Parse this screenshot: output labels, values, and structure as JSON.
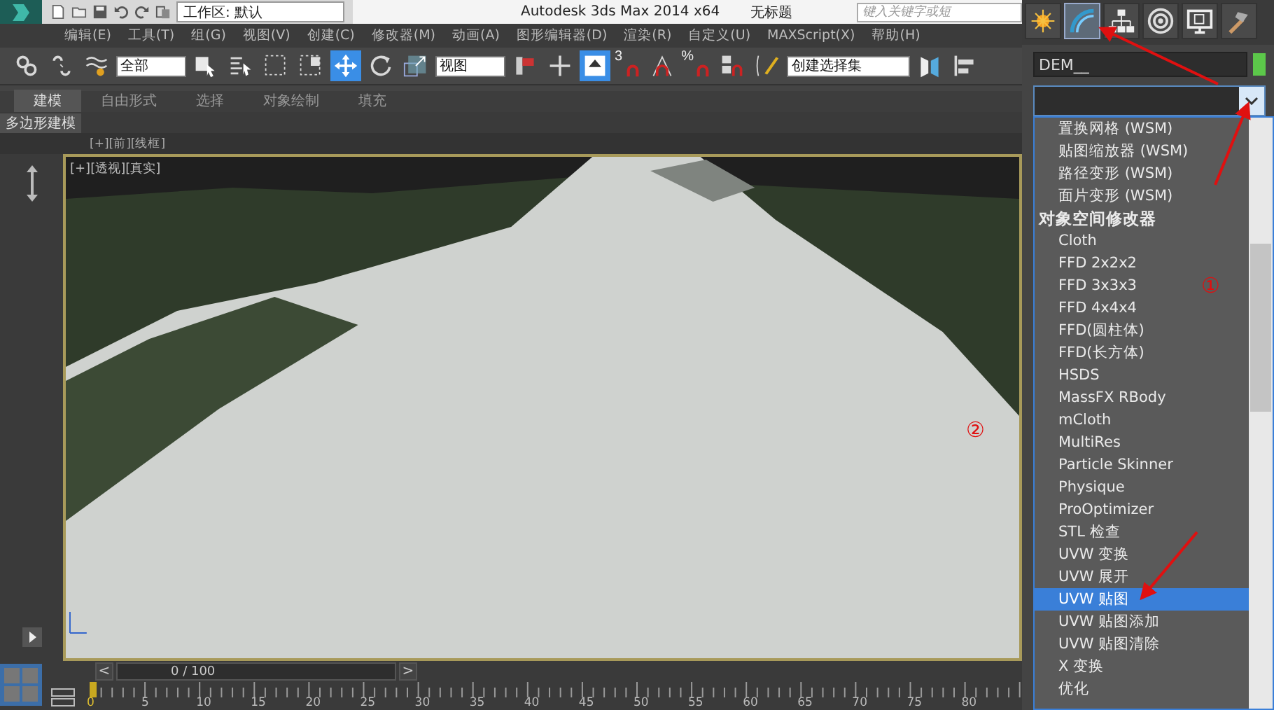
{
  "title_bar": {
    "workspace": "工作区: 默认",
    "app_title": "Autodesk 3ds Max  2014 x64",
    "document": "无标题",
    "search": {
      "placeholder": "键入关键字或短"
    }
  },
  "menu": [
    "编辑(E)",
    "工具(T)",
    "组(G)",
    "视图(V)",
    "创建(C)",
    "修改器(M)",
    "动画(A)",
    "图形编辑器(D)",
    "渲染(R)",
    "自定义(U)",
    "MAXScript(X)",
    "帮助(H)"
  ],
  "toolbar": {
    "tools": [
      {
        "kind": "link",
        "selected": false
      },
      {
        "kind": "unlink",
        "selected": false
      },
      {
        "kind": "bind",
        "selected": false
      },
      {
        "kind": "dropdown",
        "value": "全部"
      },
      {
        "kind": "select",
        "selected": false
      },
      {
        "kind": "select-by-name",
        "selected": false
      },
      {
        "kind": "region",
        "selected": false
      },
      {
        "kind": "crossing",
        "selected": false
      },
      {
        "kind": "move",
        "selected": true
      },
      {
        "kind": "rotate",
        "selected": false
      },
      {
        "kind": "scale",
        "selected": false
      },
      {
        "kind": "dropdown",
        "value": "视图"
      },
      {
        "kind": "pivot",
        "selected": false
      },
      {
        "kind": "manipulate",
        "selected": false
      },
      {
        "kind": "place",
        "selected": true
      },
      {
        "kind": "snap",
        "label": "3",
        "selected": false
      },
      {
        "kind": "angle-snap",
        "selected": false
      },
      {
        "kind": "snap",
        "label": "%",
        "selected": false
      },
      {
        "kind": "spinner-snap",
        "selected": false
      },
      {
        "kind": "edit-set",
        "selected": false
      },
      {
        "kind": "dropdown",
        "value": "创建选择集"
      },
      {
        "kind": "mirror",
        "selected": false
      },
      {
        "kind": "align",
        "selected": false
      }
    ]
  },
  "ribbon": {
    "tabs": [
      {
        "label": "建模",
        "selected": true
      },
      {
        "label": "自由形式",
        "selected": false
      },
      {
        "label": "选择",
        "selected": false
      },
      {
        "label": "对象绘制",
        "selected": false
      },
      {
        "label": "填充",
        "selected": false
      }
    ],
    "panel": "多边形建模"
  },
  "viewport": {
    "top_label": "[+][前][线框]",
    "label": "[+][透视][真实]"
  },
  "time_slider": {
    "prev": "<",
    "position": "0 / 100",
    "level": 0,
    "next": ">"
  },
  "timeline": {
    "labels": [
      "0",
      "5",
      "10",
      "15",
      "20",
      "25",
      "30",
      "35",
      "40",
      "45",
      "50",
      "55",
      "60",
      "65",
      "70",
      "75",
      "80"
    ]
  },
  "command_panel": {
    "tabs": [
      {
        "kind": "create",
        "selected": false
      },
      {
        "kind": "modify",
        "selected": true
      },
      {
        "kind": "hierarchy",
        "selected": false
      },
      {
        "kind": "motion",
        "selected": false
      },
      {
        "kind": "display",
        "selected": false
      },
      {
        "kind": "utilities",
        "selected": false
      }
    ],
    "object_name": "DEM__",
    "modifier_list": {
      "items": [
        {
          "kind": "item",
          "label": "置换网格 (WSM)",
          "selected": false
        },
        {
          "kind": "item",
          "label": "贴图缩放器 (WSM)",
          "selected": false
        },
        {
          "kind": "item",
          "label": "路径变形 (WSM)",
          "selected": false
        },
        {
          "kind": "item",
          "label": "面片变形 (WSM)",
          "selected": false
        },
        {
          "kind": "header",
          "label": "对象空间修改器",
          "selected": false
        },
        {
          "kind": "item",
          "label": "Cloth",
          "selected": false
        },
        {
          "kind": "item",
          "label": "FFD 2x2x2",
          "selected": false
        },
        {
          "kind": "item",
          "label": "FFD 3x3x3",
          "selected": false
        },
        {
          "kind": "item",
          "label": "FFD 4x4x4",
          "selected": false
        },
        {
          "kind": "item",
          "label": "FFD(圆柱体)",
          "selected": false
        },
        {
          "kind": "item",
          "label": "FFD(长方体)",
          "selected": false
        },
        {
          "kind": "item",
          "label": "HSDS",
          "selected": false
        },
        {
          "kind": "item",
          "label": "MassFX RBody",
          "selected": false
        },
        {
          "kind": "item",
          "label": "mCloth",
          "selected": false
        },
        {
          "kind": "item",
          "label": "MultiRes",
          "selected": false
        },
        {
          "kind": "item",
          "label": "Particle Skinner",
          "selected": false
        },
        {
          "kind": "item",
          "label": "Physique",
          "selected": false
        },
        {
          "kind": "item",
          "label": "ProOptimizer",
          "selected": false
        },
        {
          "kind": "item",
          "label": "STL 检查",
          "selected": false
        },
        {
          "kind": "item",
          "label": "UVW 变换",
          "selected": false
        },
        {
          "kind": "item",
          "label": "UVW 展开",
          "selected": false
        },
        {
          "kind": "item",
          "label": "UVW 贴图",
          "selected": true
        },
        {
          "kind": "item",
          "label": "UVW 贴图添加",
          "selected": false
        },
        {
          "kind": "item",
          "label": "UVW 贴图清除",
          "selected": false
        },
        {
          "kind": "item",
          "label": "X 变换",
          "selected": false
        },
        {
          "kind": "item",
          "label": "优化",
          "selected": false
        }
      ]
    }
  },
  "annotations": [
    {
      "text": "①"
    },
    {
      "text": "②"
    }
  ]
}
